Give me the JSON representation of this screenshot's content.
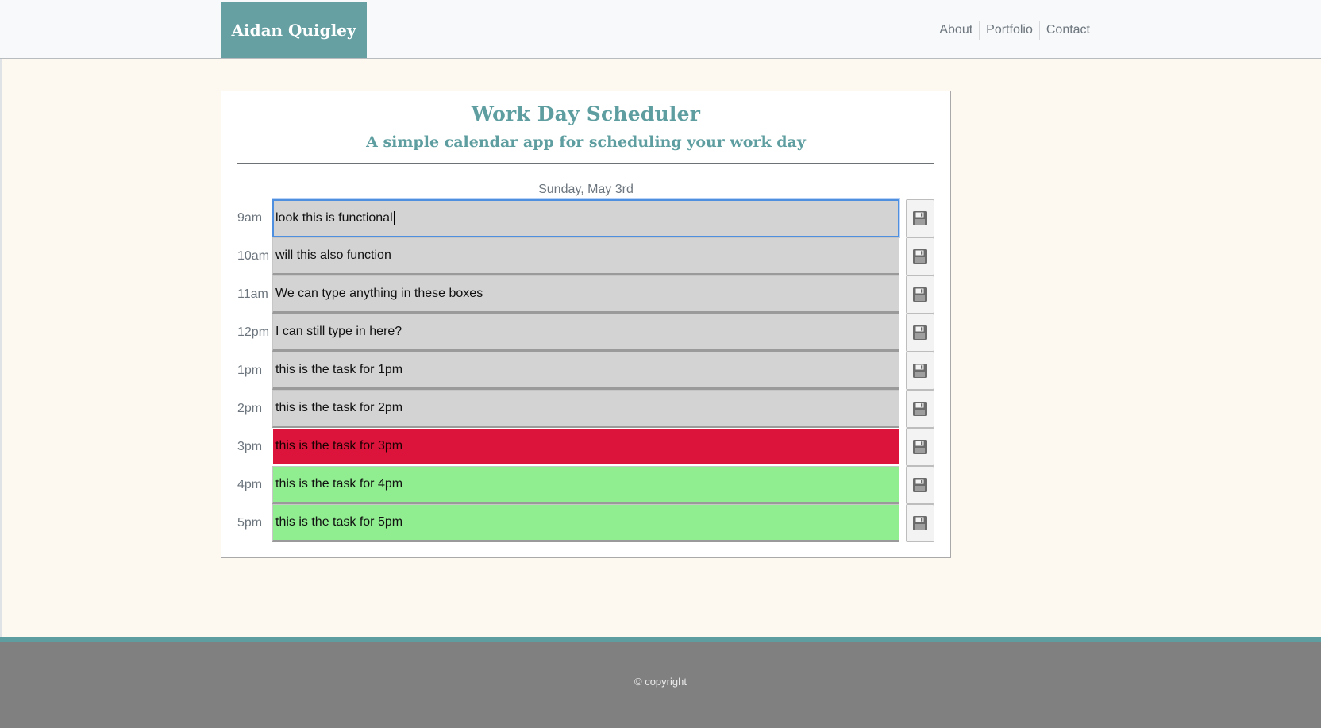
{
  "nav": {
    "brand": "Aidan Quigley",
    "links": [
      "About",
      "Portfolio",
      "Contact"
    ]
  },
  "header": {
    "title": "Work Day Scheduler",
    "subtitle": "A simple calendar app for scheduling your work day",
    "current_day": "Sunday, May 3rd"
  },
  "rows": [
    {
      "hour": "9am",
      "text": "look this is functional",
      "state": "past"
    },
    {
      "hour": "10am",
      "text": "will this also function",
      "state": "past"
    },
    {
      "hour": "11am",
      "text": "We can type anything in these boxes",
      "state": "past"
    },
    {
      "hour": "12pm",
      "text": "I can still type in here?",
      "state": "past"
    },
    {
      "hour": "1pm",
      "text": "this is the task for 1pm",
      "state": "past"
    },
    {
      "hour": "2pm",
      "text": "this is the task for 2pm",
      "state": "past"
    },
    {
      "hour": "3pm",
      "text": "this is the task for 3pm",
      "state": "present"
    },
    {
      "hour": "4pm",
      "text": "this is the task for 4pm",
      "state": "future"
    },
    {
      "hour": "5pm",
      "text": "this is the task for 5pm",
      "state": "future"
    }
  ],
  "icons": {
    "save": "floppy-disk-icon"
  },
  "colors": {
    "brand": "#66a0a3",
    "past": "#d3d3d3",
    "present": "#dc143c",
    "future": "#90ee90",
    "footer": "#808080"
  },
  "footer": {
    "copyright": "© copyright"
  }
}
